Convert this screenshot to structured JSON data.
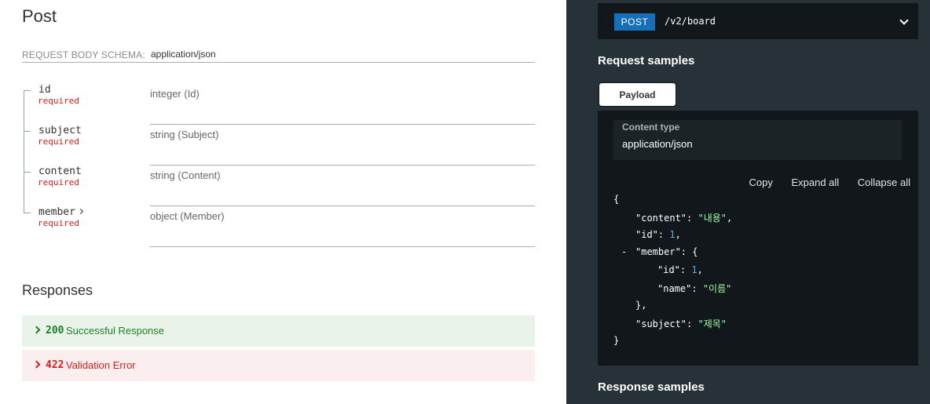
{
  "left": {
    "title": "Post",
    "schema_label": "REQUEST BODY SCHEMA:",
    "schema_value": "application/json",
    "fields": [
      {
        "name": "id",
        "required": "required",
        "type": "integer (Id)"
      },
      {
        "name": "subject",
        "required": "required",
        "type": "string (Subject)"
      },
      {
        "name": "content",
        "required": "required",
        "type": "string (Content)"
      },
      {
        "name": "member",
        "required": "required",
        "type": "object (Member)"
      }
    ],
    "responses_title": "Responses",
    "responses": [
      {
        "code": "200",
        "message": "Successful Response",
        "color": "#1d8127"
      },
      {
        "code": "422",
        "message": "Validation Error",
        "color": "#d41f1c"
      }
    ]
  },
  "right": {
    "method": "POST",
    "path": "/v2/board",
    "request_samples_title": "Request samples",
    "payload_tab": "Payload",
    "content_type_label": "Content type",
    "content_type_value": "application/json",
    "actions": {
      "copy": "Copy",
      "expand_all": "Expand all",
      "collapse_all": "Collapse all"
    },
    "json_sample": {
      "open_brace": "{",
      "content_key": "\"content\"",
      "content_val": "\"내용\"",
      "id_key": "\"id\"",
      "id_val": "1",
      "collapse_toggle": "-",
      "member_key": "\"member\"",
      "member_open": "{",
      "member_id_key": "\"id\"",
      "member_id_val": "1",
      "member_name_key": "\"name\"",
      "member_name_val": "\"이름\"",
      "member_close": "},",
      "subject_key": "\"subject\"",
      "subject_val": "\"제목\"",
      "close_brace": "}"
    },
    "response_samples_title": "Response samples"
  },
  "colors": {
    "method_post": "#186fb9",
    "right_panel": "#263238",
    "json_string": "#a0fbaa",
    "json_number": "#5fa7e6"
  }
}
